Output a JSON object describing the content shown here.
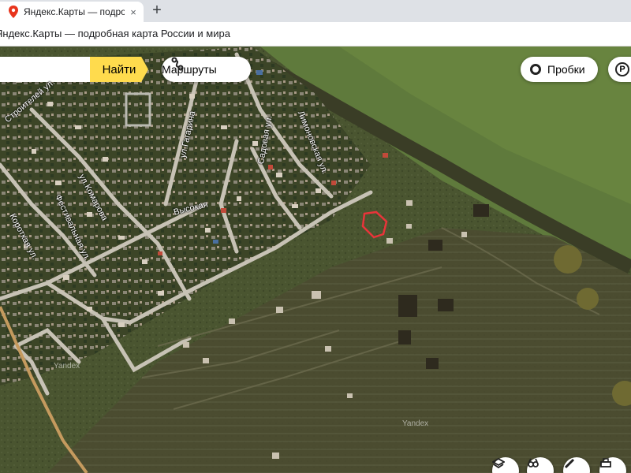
{
  "browser": {
    "tab_title": "Яндекс.Карты — подробная карта России и мира",
    "tab_close": "×",
    "new_tab": "+",
    "address_text": "Яндекс.Карты — подробная карта России и мира"
  },
  "map": {
    "search_button": "Найти",
    "routes_button": "Маршруты",
    "traffic_button": "Пробки",
    "parking_letter": "P",
    "streets": {
      "stroiteley": "Строителей ул.",
      "gagarina": "ул.Гагарина",
      "limonovskaya": "Лимоновская ул.",
      "sadovaya": "Садовая ул.",
      "vysokaya": "Высокая",
      "komarova": "ул.Комарова",
      "festivalnaya": "Фестивальная ул.",
      "korotkaya": "Короткая ул."
    },
    "watermarks": [
      "Yandex",
      "Yandex"
    ],
    "controls": [
      "layers-icon",
      "panorama-icon",
      "ruler-icon",
      "print-icon"
    ]
  }
}
